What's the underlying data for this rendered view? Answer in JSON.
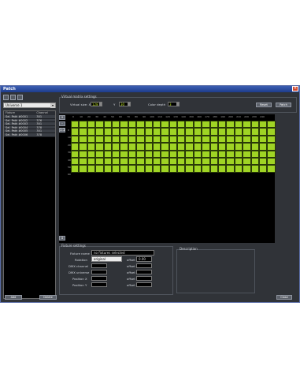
{
  "window": {
    "title": "Patch"
  },
  "sidebar": {
    "universe": "Universe 1",
    "headers": [
      "Fixture",
      "Channel"
    ],
    "rows": [
      [
        "Sel. Path #0001",
        "301"
      ],
      [
        "Sel. Path #0002",
        "376"
      ],
      [
        "Sel. Path #0003",
        "301"
      ],
      [
        "Sel. Path #0004",
        "378"
      ],
      [
        "Sel. Path #0005",
        "301"
      ],
      [
        "Sel. Path #0006",
        "378"
      ]
    ],
    "btn_left": "Add",
    "btn_right": "Delete"
  },
  "matrix_settings": {
    "group_label": "Virtual matrix settings",
    "size_label": "Virtual size: X",
    "size_x": "128",
    "size_y_label": "Y",
    "size_y": "30",
    "color_depth_label": "Color depth",
    "color_depth": "3",
    "btn_reset": "Reset",
    "btn_patch": "Patch"
  },
  "grid": {
    "cols": [
      "0",
      "10",
      "20",
      "30",
      "40",
      "50",
      "60",
      "70",
      "80",
      "90",
      "100",
      "110",
      "120",
      "130",
      "140",
      "150",
      "160",
      "170",
      "180",
      "190",
      "200",
      "210",
      "220",
      "230",
      "240"
    ],
    "rows": [
      "0",
      "10",
      "20",
      "30",
      "40",
      "50",
      "60"
    ],
    "cell_color": "#9fd424",
    "side_buttons": [
      "+",
      "-",
      "1:1",
      "↕"
    ]
  },
  "fixture_settings": {
    "group_label": "Fixture settings",
    "name_label": "Fixture name",
    "name_value": "no fixtures selected",
    "rotation_label": "Rotation",
    "rotation_value": "original",
    "offset1_label": "offset",
    "offset1_value": "0.00",
    "dmx_channel_label": "DMX channel",
    "dmx_channel": "",
    "offset2_label": "offset",
    "dmx_universe_label": "DMX universe",
    "dmx_universe": "",
    "offset3_label": "offset",
    "pos_x_label": "Position X",
    "pos_x": "",
    "offset4_label": "offset",
    "pos_y_label": "Position Y",
    "pos_y": "",
    "offset5_label": "offset",
    "description_label": "Description"
  },
  "footer": {
    "close": "Close"
  }
}
